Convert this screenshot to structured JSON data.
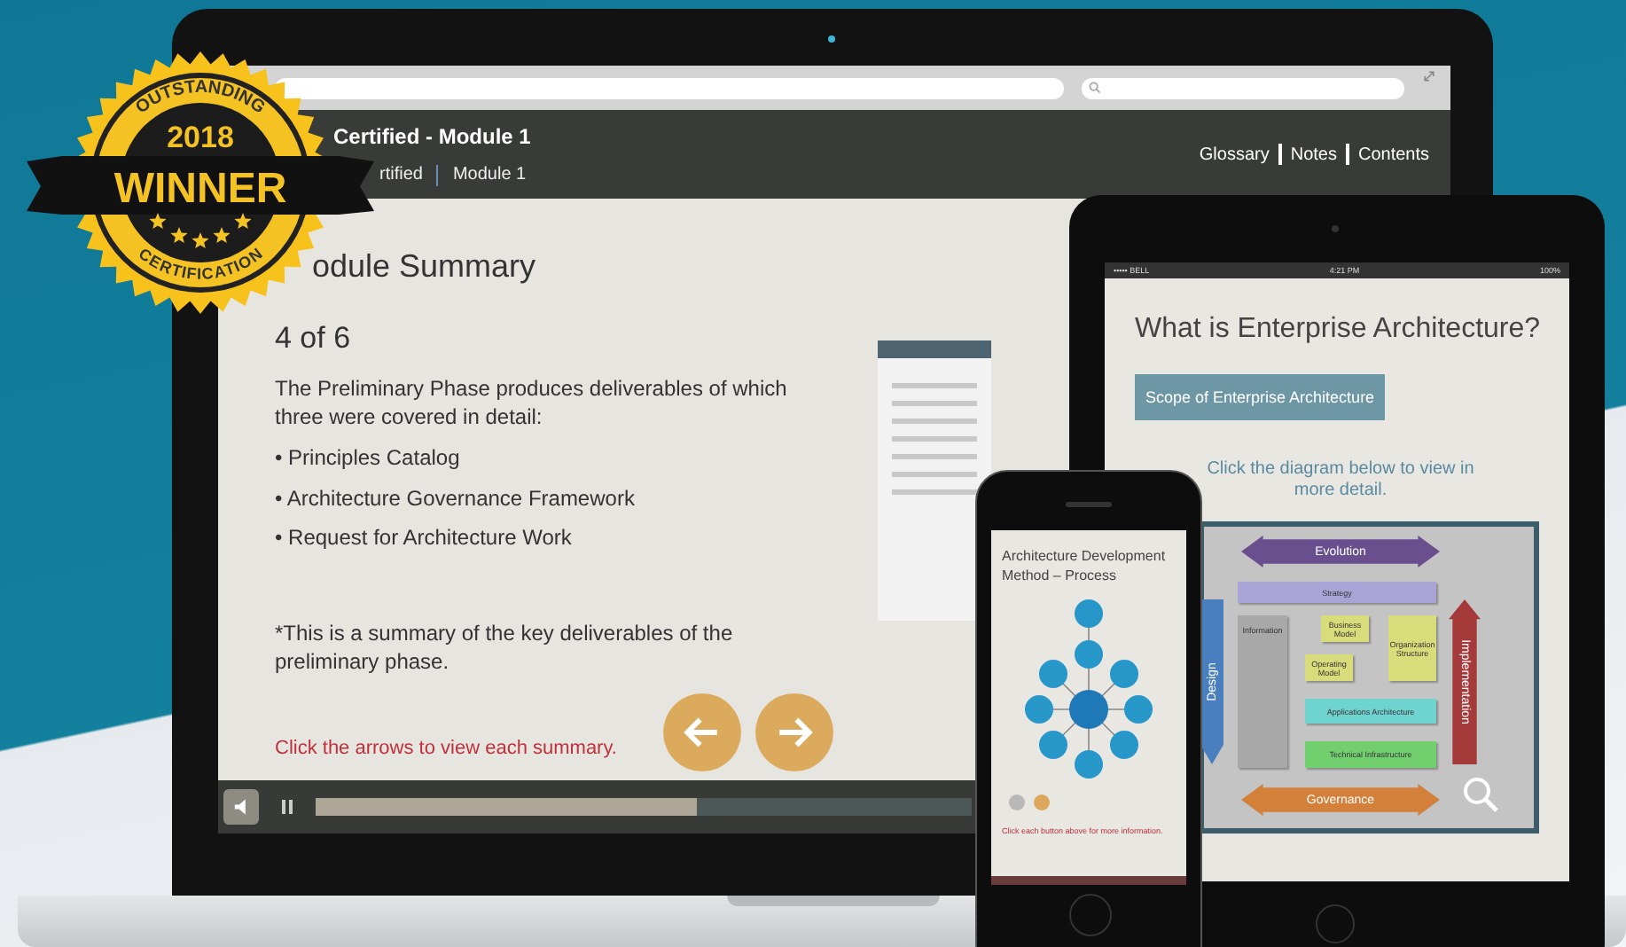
{
  "badge": {
    "arc_top": "OUTSTANDING",
    "year": "2018",
    "title": "WINNER",
    "arc_bottom": "CERTIFICATION"
  },
  "laptop": {
    "course_title": "Certified - Module 1",
    "breadcrumb": [
      "rtified",
      "Module 1"
    ],
    "header_links": [
      "Glossary",
      "Notes",
      "Contents"
    ],
    "heading": "odule Summary",
    "counter": "4 of 6",
    "intro": "The Preliminary Phase produces deliverables of which three were covered in detail:",
    "bullets": [
      "• Principles Catalog",
      "• Architecture Governance Framework",
      "• Request for Architecture Work"
    ],
    "note": "*This is a summary of the key deliverables of the preliminary phase.",
    "instruction": "Click the arrows to view each summary.",
    "nav_buttons": [
      {
        "kind": "prev"
      },
      {
        "kind": "next"
      }
    ],
    "player": {
      "level": 0.58
    }
  },
  "tablet": {
    "status": {
      "carrier": "••••• BELL",
      "time": "4:21 PM",
      "battery": "100%"
    },
    "title": "What is Enterprise Architecture?",
    "button": "Scope of Enterprise Architecture",
    "hint": "Click the diagram below to view in more detail.",
    "diagram": [
      {
        "kind": "h-arrow",
        "label": "Evolution"
      },
      {
        "kind": "bar",
        "label": "Strategy"
      },
      {
        "kind": "box",
        "label": "Information"
      },
      {
        "kind": "box",
        "label": "Business Model"
      },
      {
        "kind": "box",
        "label": "Operating Model"
      },
      {
        "kind": "box",
        "label": "Organization Structure"
      },
      {
        "kind": "bar",
        "label": "Applications Architecture"
      },
      {
        "kind": "bar",
        "label": "Technical Infrastructure"
      },
      {
        "kind": "down-arrow",
        "label": "Design"
      },
      {
        "kind": "up-arrow",
        "label": "Implementation"
      },
      {
        "kind": "h-arrow",
        "label": "Governance"
      }
    ]
  },
  "phone": {
    "title": "Architecture Development Method – Process",
    "pager": [
      {
        "selected": false
      },
      {
        "selected": true
      }
    ],
    "hint": "Click each button above for more information."
  }
}
